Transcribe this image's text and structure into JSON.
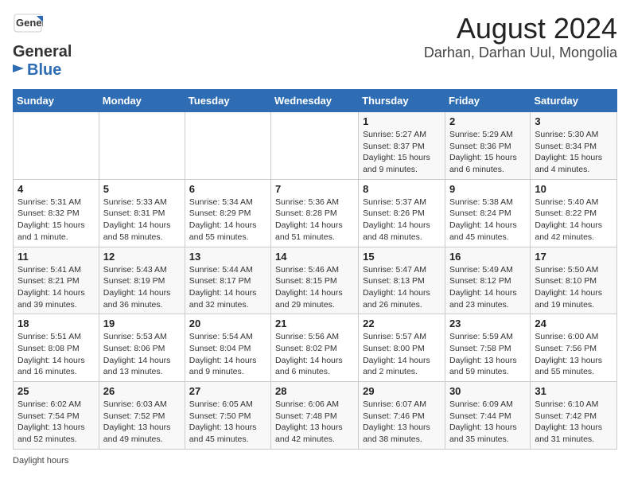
{
  "header": {
    "logo_line1": "General",
    "logo_line2": "Blue",
    "title": "August 2024",
    "subtitle": "Darhan, Darhan Uul, Mongolia"
  },
  "weekdays": [
    "Sunday",
    "Monday",
    "Tuesday",
    "Wednesday",
    "Thursday",
    "Friday",
    "Saturday"
  ],
  "weeks": [
    [
      {
        "day": "",
        "info": ""
      },
      {
        "day": "",
        "info": ""
      },
      {
        "day": "",
        "info": ""
      },
      {
        "day": "",
        "info": ""
      },
      {
        "day": "1",
        "info": "Sunrise: 5:27 AM\nSunset: 8:37 PM\nDaylight: 15 hours and 9 minutes."
      },
      {
        "day": "2",
        "info": "Sunrise: 5:29 AM\nSunset: 8:36 PM\nDaylight: 15 hours and 6 minutes."
      },
      {
        "day": "3",
        "info": "Sunrise: 5:30 AM\nSunset: 8:34 PM\nDaylight: 15 hours and 4 minutes."
      }
    ],
    [
      {
        "day": "4",
        "info": "Sunrise: 5:31 AM\nSunset: 8:32 PM\nDaylight: 15 hours and 1 minute."
      },
      {
        "day": "5",
        "info": "Sunrise: 5:33 AM\nSunset: 8:31 PM\nDaylight: 14 hours and 58 minutes."
      },
      {
        "day": "6",
        "info": "Sunrise: 5:34 AM\nSunset: 8:29 PM\nDaylight: 14 hours and 55 minutes."
      },
      {
        "day": "7",
        "info": "Sunrise: 5:36 AM\nSunset: 8:28 PM\nDaylight: 14 hours and 51 minutes."
      },
      {
        "day": "8",
        "info": "Sunrise: 5:37 AM\nSunset: 8:26 PM\nDaylight: 14 hours and 48 minutes."
      },
      {
        "day": "9",
        "info": "Sunrise: 5:38 AM\nSunset: 8:24 PM\nDaylight: 14 hours and 45 minutes."
      },
      {
        "day": "10",
        "info": "Sunrise: 5:40 AM\nSunset: 8:22 PM\nDaylight: 14 hours and 42 minutes."
      }
    ],
    [
      {
        "day": "11",
        "info": "Sunrise: 5:41 AM\nSunset: 8:21 PM\nDaylight: 14 hours and 39 minutes."
      },
      {
        "day": "12",
        "info": "Sunrise: 5:43 AM\nSunset: 8:19 PM\nDaylight: 14 hours and 36 minutes."
      },
      {
        "day": "13",
        "info": "Sunrise: 5:44 AM\nSunset: 8:17 PM\nDaylight: 14 hours and 32 minutes."
      },
      {
        "day": "14",
        "info": "Sunrise: 5:46 AM\nSunset: 8:15 PM\nDaylight: 14 hours and 29 minutes."
      },
      {
        "day": "15",
        "info": "Sunrise: 5:47 AM\nSunset: 8:13 PM\nDaylight: 14 hours and 26 minutes."
      },
      {
        "day": "16",
        "info": "Sunrise: 5:49 AM\nSunset: 8:12 PM\nDaylight: 14 hours and 23 minutes."
      },
      {
        "day": "17",
        "info": "Sunrise: 5:50 AM\nSunset: 8:10 PM\nDaylight: 14 hours and 19 minutes."
      }
    ],
    [
      {
        "day": "18",
        "info": "Sunrise: 5:51 AM\nSunset: 8:08 PM\nDaylight: 14 hours and 16 minutes."
      },
      {
        "day": "19",
        "info": "Sunrise: 5:53 AM\nSunset: 8:06 PM\nDaylight: 14 hours and 13 minutes."
      },
      {
        "day": "20",
        "info": "Sunrise: 5:54 AM\nSunset: 8:04 PM\nDaylight: 14 hours and 9 minutes."
      },
      {
        "day": "21",
        "info": "Sunrise: 5:56 AM\nSunset: 8:02 PM\nDaylight: 14 hours and 6 minutes."
      },
      {
        "day": "22",
        "info": "Sunrise: 5:57 AM\nSunset: 8:00 PM\nDaylight: 14 hours and 2 minutes."
      },
      {
        "day": "23",
        "info": "Sunrise: 5:59 AM\nSunset: 7:58 PM\nDaylight: 13 hours and 59 minutes."
      },
      {
        "day": "24",
        "info": "Sunrise: 6:00 AM\nSunset: 7:56 PM\nDaylight: 13 hours and 55 minutes."
      }
    ],
    [
      {
        "day": "25",
        "info": "Sunrise: 6:02 AM\nSunset: 7:54 PM\nDaylight: 13 hours and 52 minutes."
      },
      {
        "day": "26",
        "info": "Sunrise: 6:03 AM\nSunset: 7:52 PM\nDaylight: 13 hours and 49 minutes."
      },
      {
        "day": "27",
        "info": "Sunrise: 6:05 AM\nSunset: 7:50 PM\nDaylight: 13 hours and 45 minutes."
      },
      {
        "day": "28",
        "info": "Sunrise: 6:06 AM\nSunset: 7:48 PM\nDaylight: 13 hours and 42 minutes."
      },
      {
        "day": "29",
        "info": "Sunrise: 6:07 AM\nSunset: 7:46 PM\nDaylight: 13 hours and 38 minutes."
      },
      {
        "day": "30",
        "info": "Sunrise: 6:09 AM\nSunset: 7:44 PM\nDaylight: 13 hours and 35 minutes."
      },
      {
        "day": "31",
        "info": "Sunrise: 6:10 AM\nSunset: 7:42 PM\nDaylight: 13 hours and 31 minutes."
      }
    ]
  ],
  "footer": {
    "note": "Daylight hours"
  }
}
